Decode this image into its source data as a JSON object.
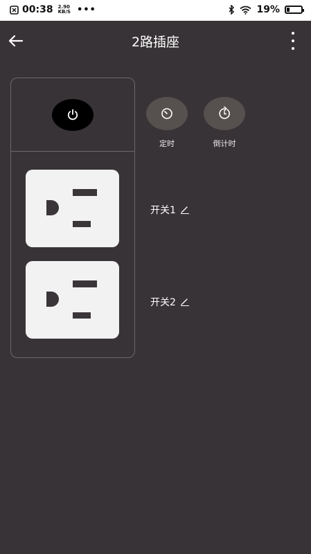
{
  "status_bar": {
    "time": "00:38",
    "net_speed_value": "2.90",
    "net_speed_unit": "KB/S",
    "more_dots": "•••",
    "battery_percent": "19%",
    "battery_level": 0.19
  },
  "header": {
    "title": "2路插座"
  },
  "actions": {
    "timer_label": "定时",
    "countdown_label": "倒计时"
  },
  "switches": [
    {
      "label": "开关1"
    },
    {
      "label": "开关2"
    }
  ],
  "icons": {
    "back": "arrow-left-icon",
    "more": "more-vertical-icon",
    "power": "power-icon",
    "timer": "timer-icon",
    "countdown": "countdown-icon",
    "edit": "pencil-icon"
  },
  "colors": {
    "background": "#383336",
    "outlet_face": "#f2f2f2",
    "button_bg": "#56514f"
  }
}
